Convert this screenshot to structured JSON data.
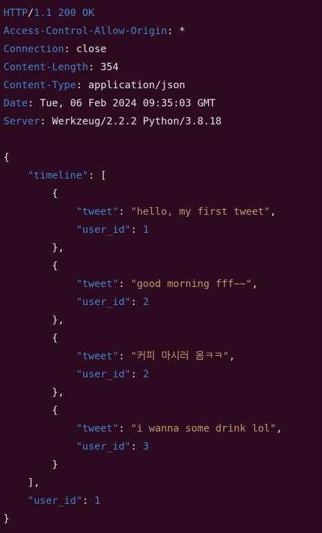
{
  "headers": {
    "status": {
      "proto": "HTTP",
      "slash": "/",
      "version": "1.1",
      "code": "200",
      "reason": "OK"
    },
    "lines": [
      {
        "key": "Access-Control-Allow-Origin",
        "value": "*"
      },
      {
        "key": "Connection",
        "value": "close"
      },
      {
        "key": "Content-Length",
        "value": "354"
      },
      {
        "key": "Content-Type",
        "value": "application/json"
      },
      {
        "key": "Date",
        "value": "Tue, 06 Feb 2024 09:35:03 GMT"
      },
      {
        "key": "Server",
        "value": "Werkzeug/2.2.2 Python/3.8.18"
      }
    ]
  },
  "json": {
    "timeline_key": "\"timeline\"",
    "tweet_key": "\"tweet\"",
    "user_id_key": "\"user_id\"",
    "timeline": [
      {
        "tweet": "\"hello, my first tweet\"",
        "user_id": "1"
      },
      {
        "tweet": "\"good morning fff~~\"",
        "user_id": "2"
      },
      {
        "tweet": "\"커피 마시러 옴ㅋㅋ\"",
        "user_id": "2"
      },
      {
        "tweet": "\"i wanna some drink lol\"",
        "user_id": "3"
      }
    ],
    "user_id": "1"
  },
  "colors": {
    "background": "#2c0a1f",
    "key_blue": "#3f86c9",
    "string": "#c5956e",
    "text": "#e8e4e6"
  }
}
